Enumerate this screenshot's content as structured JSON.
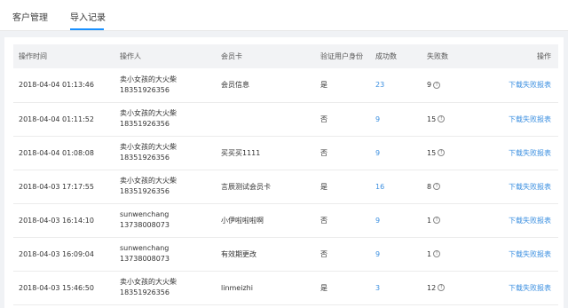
{
  "tabs": [
    {
      "label": "客户管理",
      "active": false
    },
    {
      "label": "导入记录",
      "active": true
    }
  ],
  "colors": {
    "accent": "#1890ff",
    "link": "#3b8fe0"
  },
  "table": {
    "headers": [
      "操作时间",
      "操作人",
      "会员卡",
      "验证用户身份",
      "成功数",
      "失败数",
      "操作"
    ],
    "rows": [
      {
        "time": "2018-04-04 01:13:46",
        "operator_name": "卖小女孩的大火柴",
        "operator_phone": "18351926356",
        "card": "会员信息",
        "verify": "是",
        "success": "23",
        "fail": "9",
        "action": "下载失败报表"
      },
      {
        "time": "2018-04-04 01:11:52",
        "operator_name": "卖小女孩的大火柴",
        "operator_phone": "18351926356",
        "card": "",
        "verify": "否",
        "success": "9",
        "fail": "15",
        "action": "下载失败报表"
      },
      {
        "time": "2018-04-04 01:08:08",
        "operator_name": "卖小女孩的大火柴",
        "operator_phone": "18351926356",
        "card": "买买买1111",
        "verify": "否",
        "success": "9",
        "fail": "15",
        "action": "下载失败报表"
      },
      {
        "time": "2018-04-03 17:17:55",
        "operator_name": "卖小女孩的大火柴",
        "operator_phone": "18351926356",
        "card": "言辰测试会员卡",
        "verify": "是",
        "success": "16",
        "fail": "8",
        "action": "下载失败报表"
      },
      {
        "time": "2018-04-03 16:14:10",
        "operator_name": "sunwenchang",
        "operator_phone": "13738008073",
        "card": "小伊啦啦啦啊",
        "verify": "否",
        "success": "9",
        "fail": "1",
        "action": "下载失败报表"
      },
      {
        "time": "2018-04-03 16:09:04",
        "operator_name": "sunwenchang",
        "operator_phone": "13738008073",
        "card": "有效期更改",
        "verify": "否",
        "success": "9",
        "fail": "1",
        "action": "下载失败报表"
      },
      {
        "time": "2018-04-03 15:46:50",
        "operator_name": "卖小女孩的大火柴",
        "operator_phone": "18351926356",
        "card": "linmeizhi",
        "verify": "是",
        "success": "3",
        "fail": "12",
        "action": "下载失败报表"
      }
    ]
  }
}
